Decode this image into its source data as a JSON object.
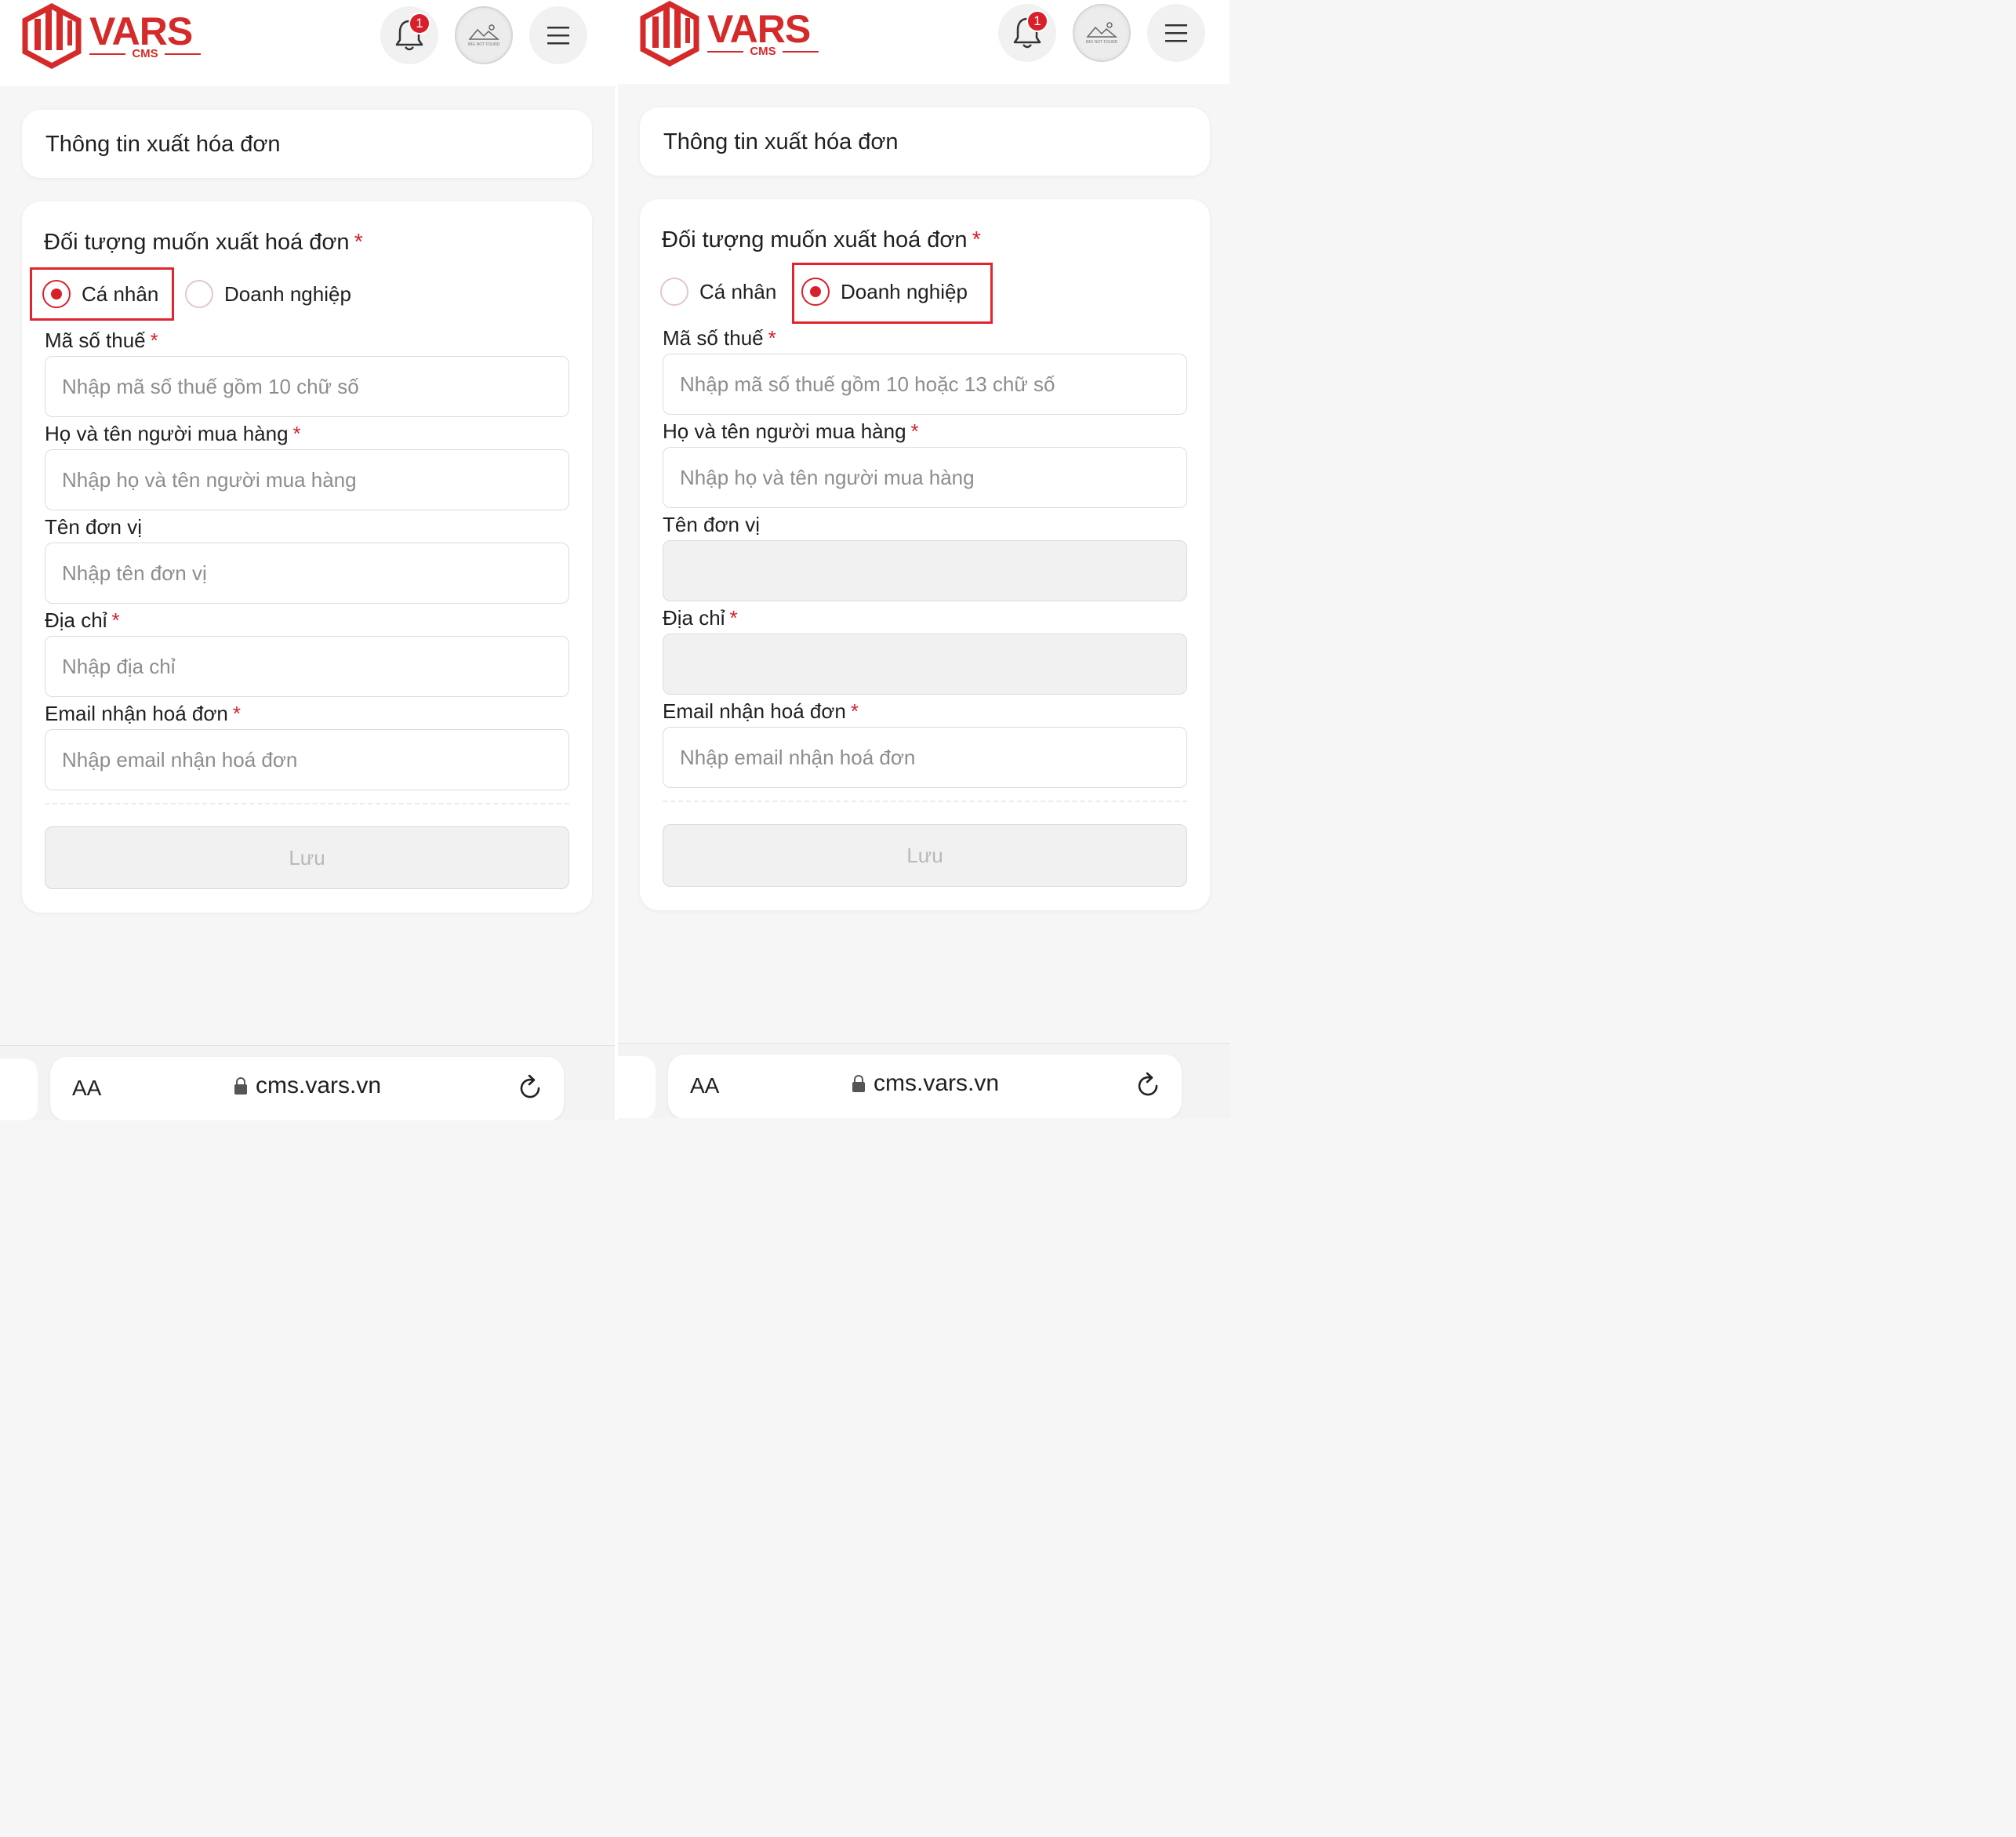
{
  "brand": {
    "name": "VARS",
    "sub": "CMS"
  },
  "header": {
    "notification_count": "1",
    "avatar_placeholder": "IMG NOT FOUND"
  },
  "page_title": "Thông tin xuất hóa đơn",
  "form": {
    "target_label": "Đối tượng muốn xuất hoá đơn",
    "required_mark": "*",
    "options": [
      "Cá nhân",
      "Doanh nghiệp"
    ],
    "tax_label": "Mã số thuế",
    "buyer_label": "Họ và tên người mua hàng",
    "buyer_placeholder": "Nhập họ và tên người mua hàng",
    "unit_label": "Tên đơn vị",
    "unit_placeholder": "Nhập tên đơn vị",
    "address_label": "Địa chỉ",
    "address_placeholder": "Nhập địa chỉ",
    "email_label": "Email nhận hoá đơn",
    "email_placeholder": "Nhập email nhận hoá đơn",
    "save_label": "Lưu"
  },
  "left": {
    "selected_option": "Cá nhân",
    "tax_placeholder": "Nhập mã số thuế gồm 10 chữ số"
  },
  "right": {
    "selected_option": "Doanh nghiệp",
    "tax_placeholder": "Nhập mã số thuế gồm 10 hoặc 13 chữ số"
  },
  "browser": {
    "text_size_label": "AA",
    "url": "cms.vars.vn"
  },
  "colors": {
    "accent": "#d8202a",
    "highlight": "#e0252e"
  }
}
